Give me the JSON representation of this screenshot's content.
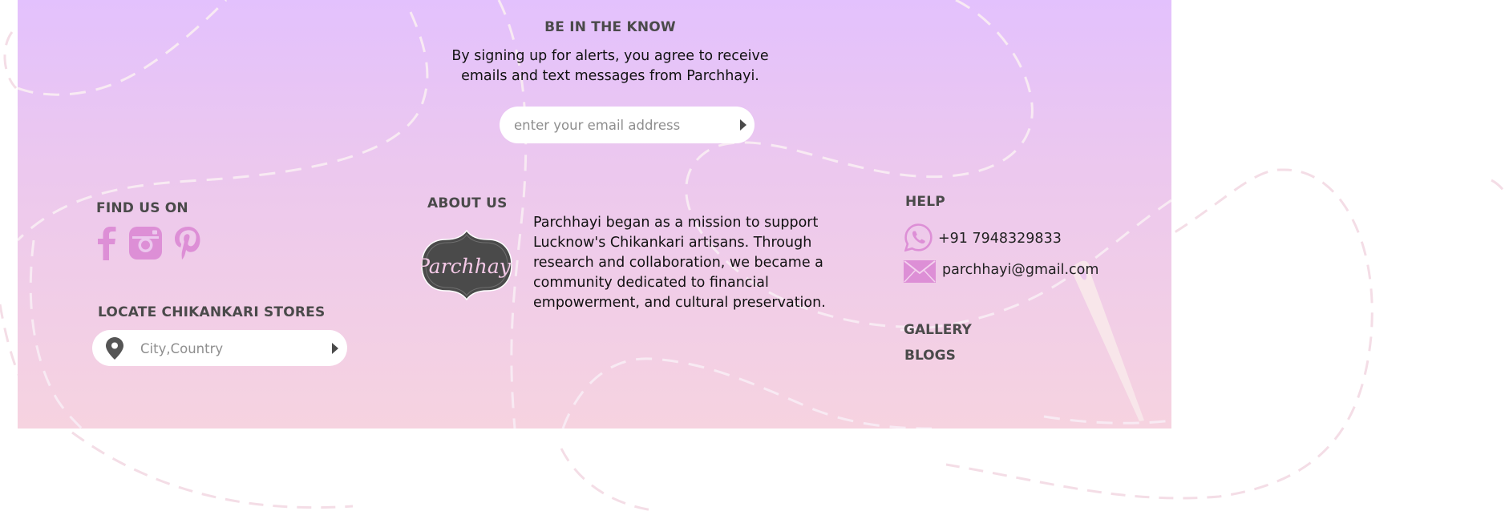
{
  "newsletter": {
    "title": "BE IN THE KNOW",
    "description": "By signing up for alerts, you agree to receive emails and text messages from Parchhayi.",
    "email_placeholder": "enter your email address"
  },
  "find_us": {
    "title": "FIND US ON",
    "icons": [
      "facebook-icon",
      "instagram-icon",
      "pinterest-icon"
    ]
  },
  "locate": {
    "title": "LOCATE CHIKANKARI STORES",
    "placeholder": "City,Country"
  },
  "about": {
    "title": "ABOUT US",
    "logo_text": "Parchhayi",
    "text": "Parchhayi began as a mission to support Lucknow's Chikankari artisans. Through research and collaboration, we became a community dedicated to financial empowerment, and cultural preservation."
  },
  "help": {
    "title": "HELP",
    "phone": "+91 7948329833",
    "email": "parchhayi@gmail.com"
  },
  "links": {
    "gallery": "GALLERY",
    "blogs": "BLOGS"
  },
  "colors": {
    "gradient_top": "#e3c1fd",
    "gradient_bottom": "#f6d3e0",
    "icon_pink": "#dd8fd6",
    "heading_gray": "#4a4a4a"
  }
}
